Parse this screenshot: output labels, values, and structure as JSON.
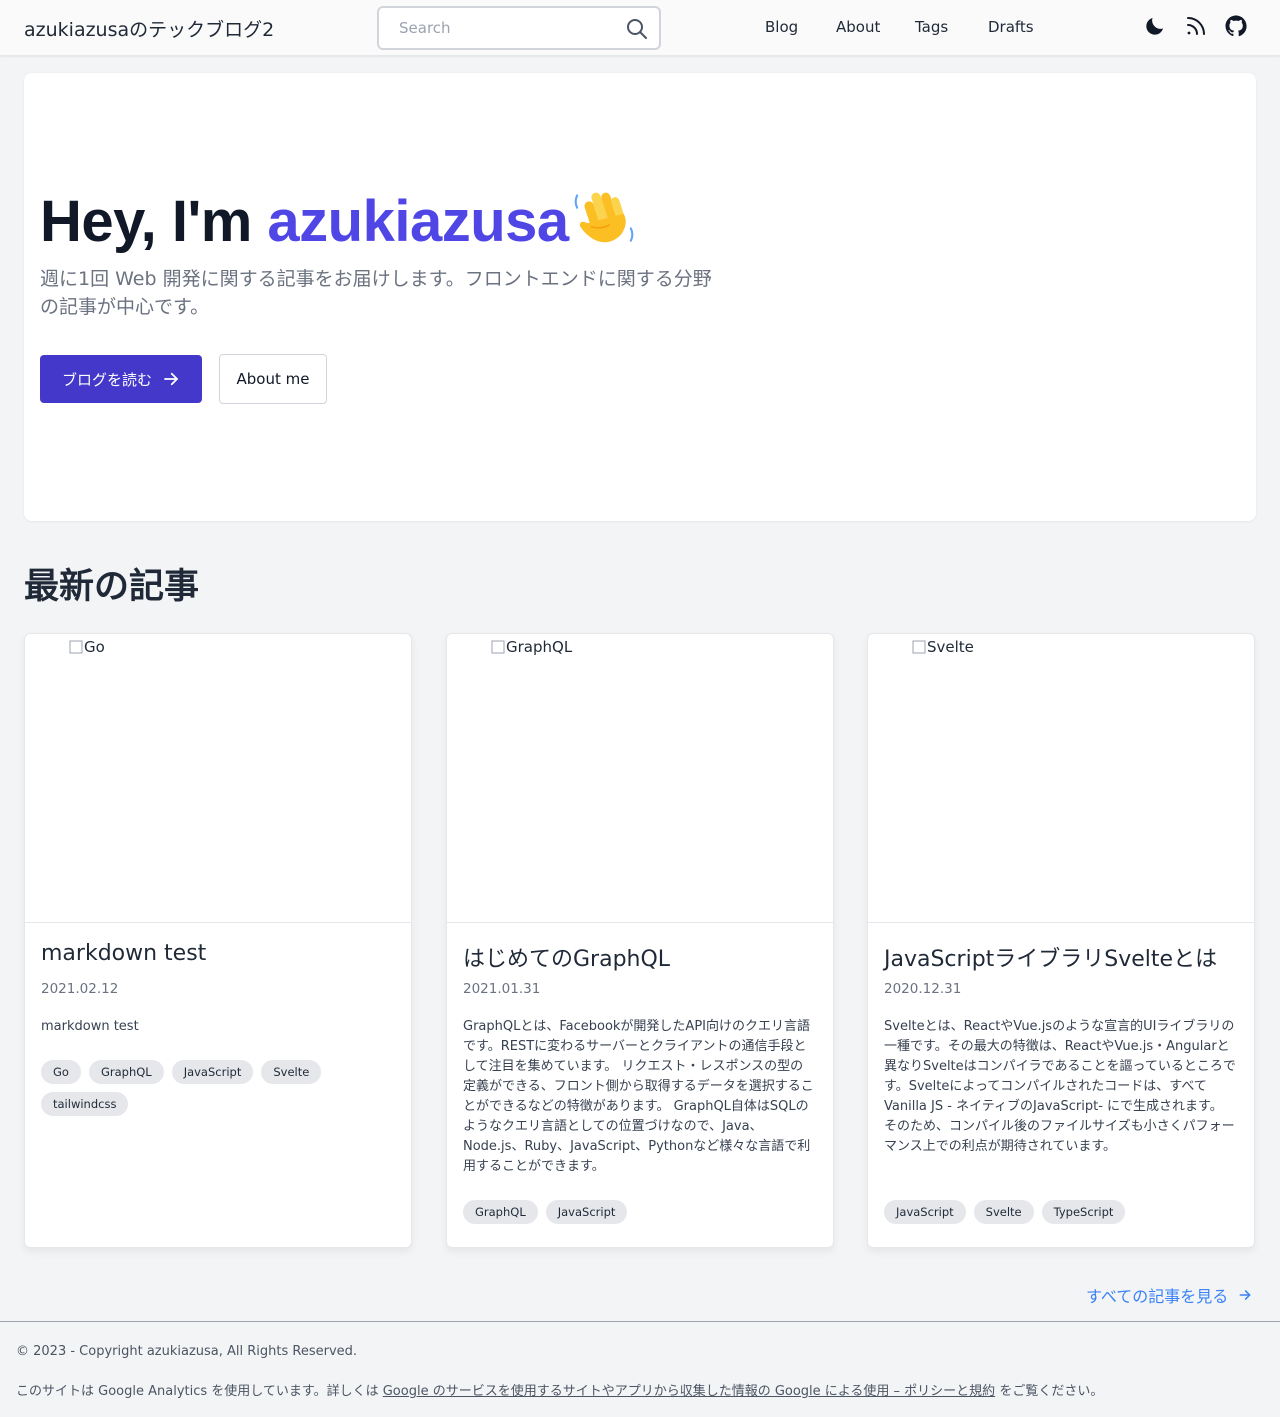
{
  "header": {
    "site_title": "azukiazusaのテックブログ2",
    "search_placeholder": "Search",
    "nav": [
      "Blog",
      "About",
      "Tags",
      "Drafts"
    ],
    "icons": [
      "moon-icon",
      "rss-icon",
      "github-icon"
    ]
  },
  "hero": {
    "greeting": "Hey, I'm ",
    "name": "azukiazusa",
    "emoji": "waving-hand",
    "description": "週に1回 Web 開発に関する記事をお届けします。フロントエンドに関する分野の記事が中心です。",
    "primary_button": "ブログを読む",
    "secondary_button": "About me"
  },
  "latest": {
    "title": "最新の記事",
    "articles": [
      {
        "image_alt": "Go",
        "title": "markdown test",
        "date": "2021.02.12",
        "description": "markdown test",
        "tags": [
          "Go",
          "GraphQL",
          "JavaScript",
          "Svelte",
          "tailwindcss"
        ]
      },
      {
        "image_alt": "GraphQL",
        "title": "はじめてのGraphQL",
        "date": "2021.01.31",
        "description": "GraphQLとは、Facebookが開発したAPI向けのクエリ言語です。RESTに変わるサーバーとクライアントの通信手段として注目を集めています。 リクエスト・レスポンスの型の定義ができる、フロント側から取得するデータを選択することができるなどの特徴があります。 GraphQL自体はSQLのようなクエリ言語としての位置づけなので、Java、Node.js、Ruby、JavaScript、Pythonなど様々な言語で利用することができます。",
        "tags": [
          "GraphQL",
          "JavaScript"
        ]
      },
      {
        "image_alt": "Svelte",
        "title": "JavaScriptライブラリSvelteとは",
        "date": "2020.12.31",
        "description": "Svelteとは、ReactやVue.jsのような宣言的UIライブラリの一種です。その最大の特徴は、ReactやVue.js・Angularと異なりSvelteはコンパイラであることを謳っているところです。Svelteによってコンパイルされたコードは、すべてVanilla JS - ネイティブのJavaScript- にで生成されます。 そのため、コンパイル後のファイルサイズも小さくパフォーマンス上での利点が期待されています。",
        "tags": [
          "JavaScript",
          "Svelte",
          "TypeScript"
        ]
      }
    ],
    "see_all": "すべての記事を見る"
  },
  "footer": {
    "copyright": "© 2023 - Copyright azukiazusa, All Rights Reserved.",
    "ga_prefix": "このサイトは Google Analytics を使用しています。詳しくは ",
    "ga_link": "Google のサービスを使用するサイトやアプリから収集した情報の Google による使用 – ポリシーと規約",
    "ga_suffix": " をご覧ください。"
  },
  "colors": {
    "accent": "#4f46e5",
    "primary_button": "#4338ca",
    "link": "#3b82f6",
    "background": "#f3f4f6",
    "tag_bg": "#e5e7eb"
  }
}
